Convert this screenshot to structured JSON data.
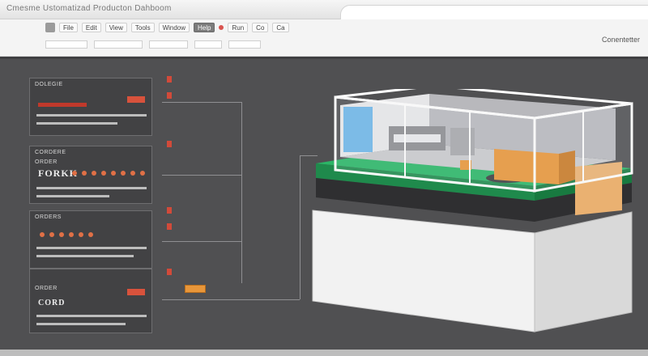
{
  "window": {
    "title": "Cmesme Ustomatizad Producton Dahboom"
  },
  "toolbar": {
    "buttons": [
      "File",
      "Edit",
      "View",
      "Tools",
      "Window",
      "Help",
      "Run"
    ],
    "right_buttons": [
      "Co",
      "Ca"
    ],
    "status_text": "Conentetter"
  },
  "panels": [
    {
      "title": "DOLEGIE",
      "heading": "",
      "dots": 3
    },
    {
      "title": "CORDERE",
      "heading": "FORKK",
      "subtitle": "ORDER",
      "dots": 8
    },
    {
      "title": "ORDERS",
      "heading": "",
      "dots": 6
    },
    {
      "title": "ORDER",
      "heading": "CORD",
      "dots": 0
    }
  ],
  "colors": {
    "workspace": "#505052",
    "accent_green": "#2bb566",
    "box_orange": "#e8963a",
    "alert_red": "#d24a3a"
  },
  "icons": [
    "factory-model-icon",
    "chair-icon",
    "crate-icon"
  ]
}
